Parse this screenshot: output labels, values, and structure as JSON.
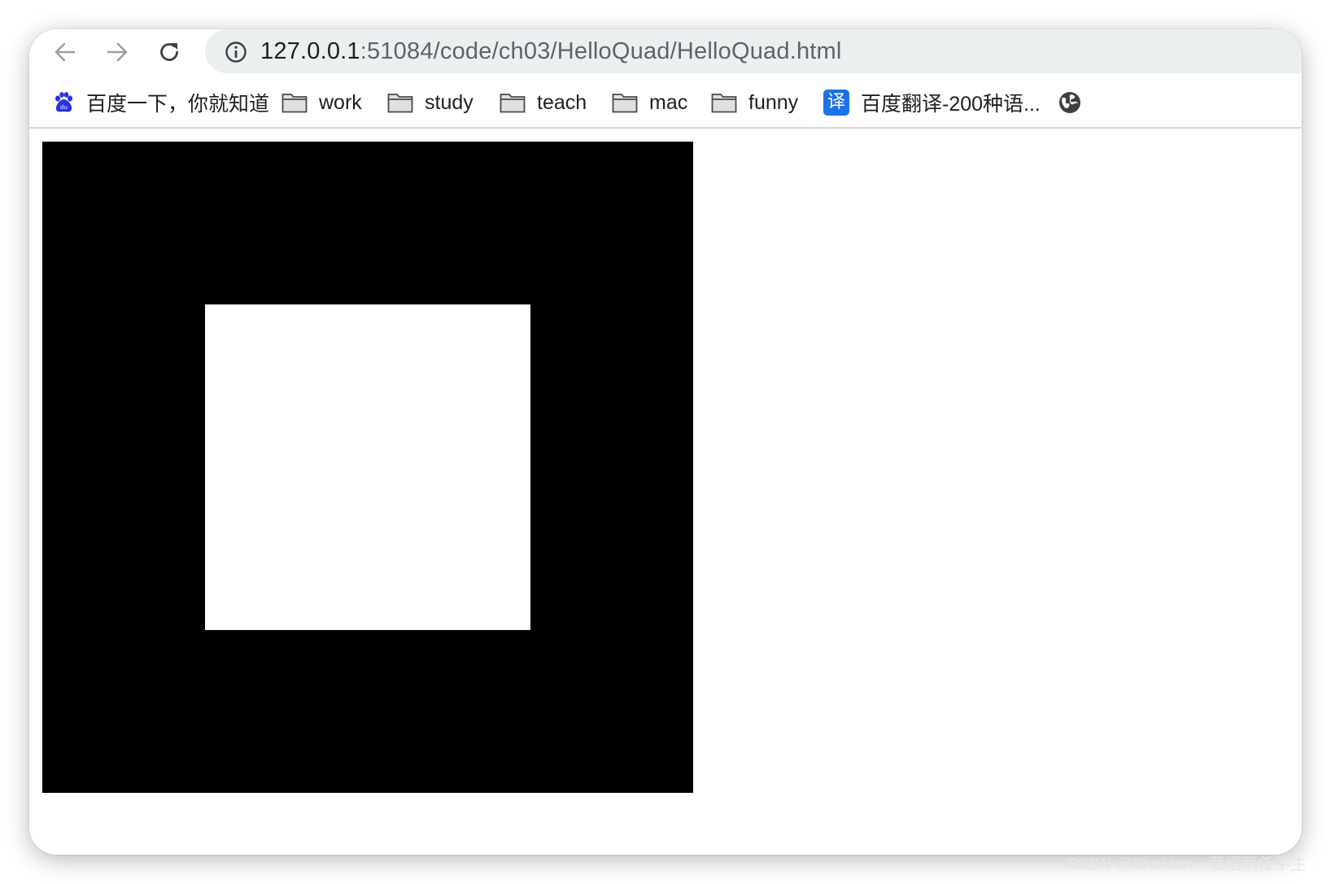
{
  "browser": {
    "url_host": "127.0.0.1",
    "url_path": ":51084/code/ch03/HelloQuad/HelloQuad.html"
  },
  "bookmarks": [
    {
      "label": "百度一下，你就知道",
      "icon": "baidu-paw-icon"
    },
    {
      "label": "work",
      "icon": "folder-icon"
    },
    {
      "label": "study",
      "icon": "folder-icon"
    },
    {
      "label": "teach",
      "icon": "folder-icon"
    },
    {
      "label": "mac",
      "icon": "folder-icon"
    },
    {
      "label": "funny",
      "icon": "folder-icon"
    },
    {
      "label": "百度翻译-200种语...",
      "icon": "translate-icon",
      "icon_text": "译"
    },
    {
      "label": "",
      "icon": "globe-icon"
    }
  ],
  "page": {
    "canvas_background": "#000000",
    "quad_color": "#ffffff"
  },
  "watermark": "CSDN @Sheldon一蓑烟雨任平生",
  "colors": {
    "omnibox_bg": "#ecefef",
    "translate_blue": "#1a73e8",
    "baidu_blue": "#2932e1"
  }
}
